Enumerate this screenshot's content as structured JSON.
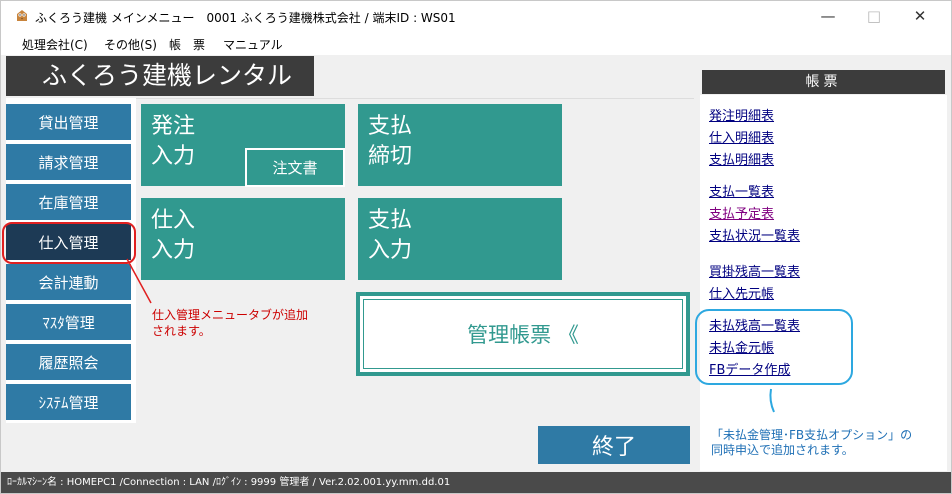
{
  "window": {
    "title": "ふくろう建機 メインメニュー　0001 ふくろう建機株式会社 / 端末ID : WS01",
    "controls": {
      "minimize": "—",
      "maximize": "□",
      "close": "✕"
    }
  },
  "menubar": {
    "items": [
      "処理会社(C)",
      "その他(S)",
      "帳　票",
      "マニュアル"
    ]
  },
  "header": {
    "title": "ふくろう建機レンタル",
    "report_header": "帳票"
  },
  "sidebar": {
    "items": [
      {
        "label": "貸出管理"
      },
      {
        "label": "請求管理"
      },
      {
        "label": "在庫管理"
      },
      {
        "label": "仕入管理"
      },
      {
        "label": "会計連動"
      },
      {
        "label": "ﾏｽﾀ管理"
      },
      {
        "label": "履歴照会"
      },
      {
        "label": "ｼｽﾃﾑ管理"
      }
    ],
    "active_index": 3
  },
  "tiles": {
    "order_entry": "発注\n入力",
    "purchase_order": "注文書",
    "payment_close": "支払\n締切",
    "purchase_entry": "仕入\n入力",
    "payment_entry": "支払\n入力"
  },
  "report_box": "管理帳票 《",
  "exit_button": "終了",
  "reports": [
    {
      "label": "発注明細表"
    },
    {
      "label": "仕入明細表"
    },
    {
      "label": "支払明細表"
    },
    {
      "label": "支払一覧表"
    },
    {
      "label": "支払予定表"
    },
    {
      "label": "支払状況一覧表"
    },
    {
      "label": "買掛残高一覧表"
    },
    {
      "label": "仕入先元帳"
    },
    {
      "label": "未払残高一覧表"
    },
    {
      "label": "未払金元帳"
    },
    {
      "label": "FBデータ作成"
    }
  ],
  "annotations": {
    "left": [
      "仕入管理メニュータブが追加",
      "されます。"
    ],
    "right": [
      "「未払金管理･FB支払オプション」の",
      "同時申込で追加されます。"
    ]
  },
  "status_bar": "ﾛｰｶﾙﾏｼｰﾝ名 : HOMEPC1  /Connection : LAN  /ﾛｸﾞｲﾝ : 9999 管理者  / Ver.2.02.001.yy.mm.dd.01",
  "colors": {
    "tile": "#31998f",
    "side_button": "#2f7aa5",
    "side_active": "#1d3a55",
    "header": "#3c3c3c",
    "annotation_red": "#e02020",
    "annotation_blue": "#2da8e0",
    "visited_link": "#800080"
  }
}
